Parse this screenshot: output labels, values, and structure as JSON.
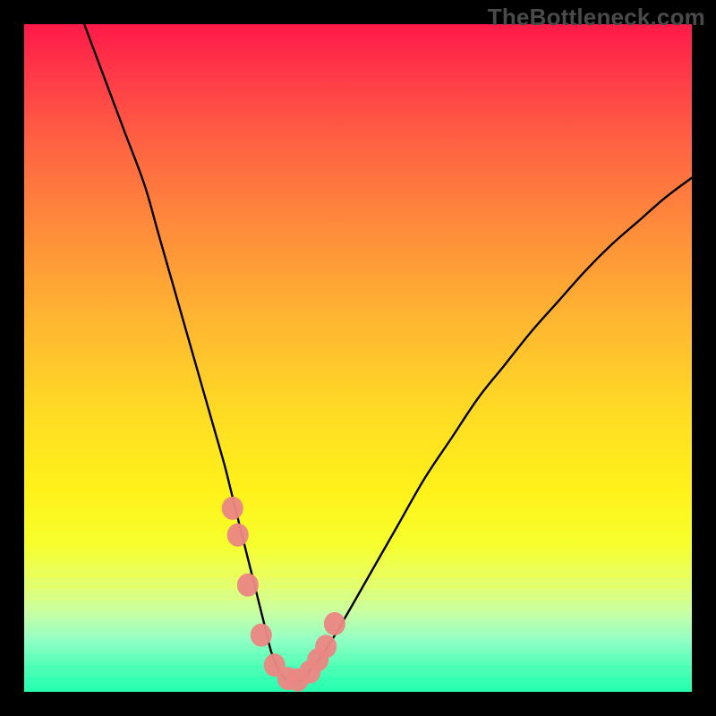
{
  "watermark": "TheBottleneck.com",
  "chart_data": {
    "type": "line",
    "title": "",
    "xlabel": "",
    "ylabel": "",
    "xlim": [
      0,
      100
    ],
    "ylim": [
      0,
      100
    ],
    "series": [
      {
        "name": "bottleneck-curve",
        "x": [
          9,
          12,
          15,
          18,
          20,
          22,
          24,
          26,
          28,
          30,
          31,
          32,
          33,
          34,
          35,
          36,
          37,
          38,
          39,
          40,
          41,
          42,
          43,
          45,
          48,
          52,
          56,
          60,
          64,
          68,
          72,
          76,
          80,
          84,
          88,
          92,
          96,
          100
        ],
        "values": [
          100,
          92,
          84,
          76,
          69,
          62,
          55,
          48,
          41,
          34,
          30,
          26,
          22,
          18,
          14,
          10,
          6,
          3.5,
          2,
          1.5,
          1.5,
          2,
          3.5,
          6,
          11,
          18,
          25,
          32,
          38,
          44,
          49,
          54,
          58.5,
          63,
          67,
          70.5,
          74,
          77
        ]
      }
    ],
    "markers": {
      "name": "highlight-points",
      "color": "#eb8783",
      "points_x": [
        31.2,
        32.0,
        33.5,
        35.5,
        37.5,
        39.5,
        41.0,
        42.8,
        44.0,
        45.2,
        46.5
      ],
      "points_y": [
        27.5,
        23.5,
        16.0,
        8.5,
        4.0,
        2.0,
        1.8,
        3.0,
        4.8,
        6.8,
        10.2
      ]
    },
    "bands": {
      "positions_pct": [
        82.5,
        84.2,
        85.9,
        87.6,
        89.3,
        91.0,
        92.7,
        94.4,
        96.1,
        97.8
      ],
      "colors": [
        "#f4ff38",
        "#ecff55",
        "#e1ff76",
        "#d1ff94",
        "#bdffad",
        "#a2ffbe",
        "#82ffc1",
        "#5fffbe",
        "#3dffb6",
        "#25ffaf"
      ]
    }
  }
}
